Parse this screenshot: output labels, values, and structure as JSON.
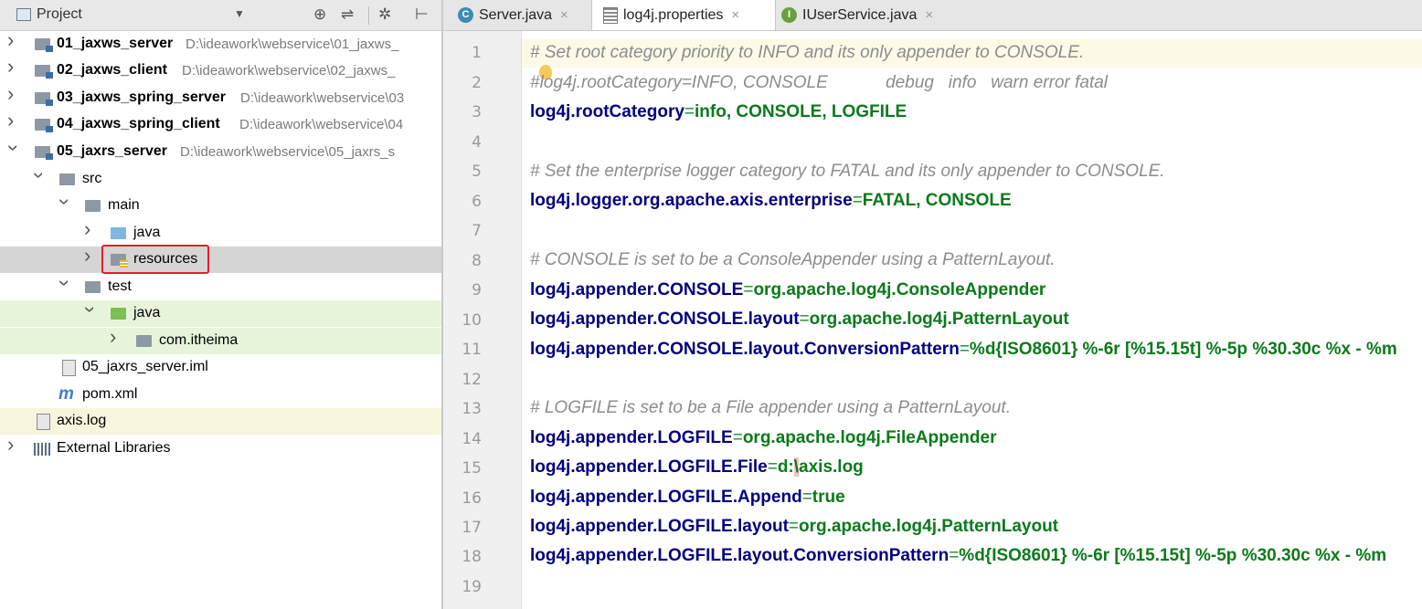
{
  "project_panel": {
    "title": "Project",
    "dropdown": "▼",
    "tools": [
      "⊕",
      "⇌",
      "✲",
      "⊢"
    ]
  },
  "tree": [
    {
      "name": "01_jaxws_server",
      "path": "D:\\ideawork\\webservice\\01_jaxws_",
      "bold": true
    },
    {
      "name": "02_jaxws_client",
      "path": "D:\\ideawork\\webservice\\02_jaxws_",
      "bold": true
    },
    {
      "name": "03_jaxws_spring_server",
      "path": "D:\\ideawork\\webservice\\03",
      "bold": true
    },
    {
      "name": "04_jaxws_spring_client",
      "path": "D:\\ideawork\\webservice\\04",
      "bold": true
    },
    {
      "name": "05_jaxrs_server",
      "path": "D:\\ideawork\\webservice\\05_jaxrs_s",
      "bold": true
    },
    {
      "name": "src"
    },
    {
      "name": "main"
    },
    {
      "name": "java"
    },
    {
      "name": "resources"
    },
    {
      "name": "test"
    },
    {
      "name": "java"
    },
    {
      "name": "com.itheima"
    },
    {
      "name": "05_jaxrs_server.iml"
    },
    {
      "name": "pom.xml"
    },
    {
      "name": "axis.log"
    },
    {
      "name": "External Libraries"
    }
  ],
  "tabs": [
    {
      "label": "Server.java",
      "icon": "c-class-icon"
    },
    {
      "label": "log4j.properties",
      "icon": "properties-file-icon"
    },
    {
      "label": "IUserService.java",
      "icon": "interface-icon"
    }
  ],
  "close_glyph": "×",
  "editor": {
    "lines": [
      {
        "n": "1",
        "comment": "# Set root category priority to INFO and its only appender to CONSOLE."
      },
      {
        "n": "2",
        "comment": "#log4j.rootCategory=INFO, CONSOLE            debug   info   warn error fatal"
      },
      {
        "n": "3",
        "key": "log4j.rootCategory",
        "val": "info, CONSOLE, LOGFILE"
      },
      {
        "n": "4"
      },
      {
        "n": "5",
        "comment": "# Set the enterprise logger category to FATAL and its only appender to CONSOLE."
      },
      {
        "n": "6",
        "key": "log4j.logger.org.apache.axis.enterprise",
        "val": "FATAL, CONSOLE"
      },
      {
        "n": "7"
      },
      {
        "n": "8",
        "comment": "# CONSOLE is set to be a ConsoleAppender using a PatternLayout."
      },
      {
        "n": "9",
        "key": "log4j.appender.CONSOLE",
        "val": "org.apache.log4j.ConsoleAppender"
      },
      {
        "n": "10",
        "key": "log4j.appender.CONSOLE.layout",
        "val": "org.apache.log4j.PatternLayout"
      },
      {
        "n": "11",
        "key": "log4j.appender.CONSOLE.layout.ConversionPattern",
        "val": "%d{ISO8601} %-6r [%15.15t] %-5p %30.30c %x - %m"
      },
      {
        "n": "12"
      },
      {
        "n": "13",
        "comment": "# LOGFILE is set to be a File appender using a PatternLayout."
      },
      {
        "n": "14",
        "key": "log4j.appender.LOGFILE",
        "val": "org.apache.log4j.FileAppender"
      },
      {
        "n": "15",
        "key": "log4j.appender.LOGFILE.File",
        "val_pre": "d:",
        "val_hl": "\\",
        "val_post": "axis.log"
      },
      {
        "n": "16",
        "key": "log4j.appender.LOGFILE.Append",
        "val": "true"
      },
      {
        "n": "17",
        "key": "log4j.appender.LOGFILE.layout",
        "val": "org.apache.log4j.PatternLayout"
      },
      {
        "n": "18",
        "key": "log4j.appender.LOGFILE.layout.ConversionPattern",
        "val": "%d{ISO8601} %-6r [%15.15t] %-5p %30.30c %x - %m"
      },
      {
        "n": "19"
      }
    ],
    "eq": "="
  },
  "colors": {
    "comment": "#8c8c8c",
    "key": "#000080",
    "value": "#0a7a1a",
    "selection_box": "#e0202a"
  }
}
